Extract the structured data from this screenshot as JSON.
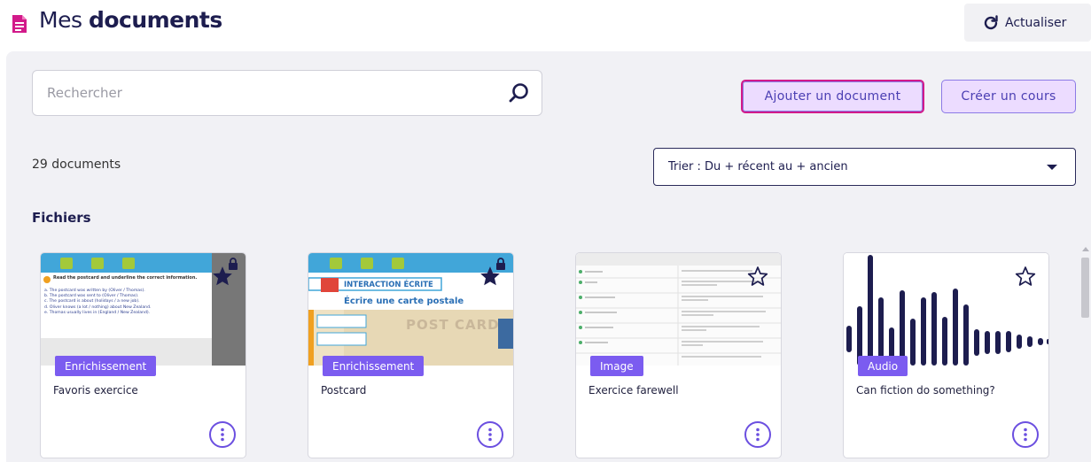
{
  "header": {
    "title_light": "Mes ",
    "title_bold": "documents",
    "refresh_label": "Actualiser"
  },
  "toolbar": {
    "search_placeholder": "Rechercher",
    "add_document_label": "Ajouter un document",
    "create_course_label": "Créer un cours"
  },
  "list": {
    "count_label": "29 documents",
    "sort_label": "Trier : Du + récent au + ancien",
    "section_title": "Fichiers"
  },
  "cards": [
    {
      "title": "Favoris exercice",
      "badge": "Enrichissement",
      "starred": true,
      "locked": true
    },
    {
      "title": "Postcard",
      "badge": "Enrichissement",
      "starred": true,
      "locked": true
    },
    {
      "title": "Exercice farewell",
      "badge": "Image",
      "starred": false,
      "locked": false
    },
    {
      "title": "Can fiction do something?",
      "badge": "Audio",
      "starred": false,
      "locked": false
    }
  ],
  "thumbs": {
    "exercise": {
      "instruction": "Read the postcard and underline the correct information.",
      "lines": [
        "a. The postcard was written by (Oliver / Thomas).",
        "b. The postcard was sent to (Oliver / Thomas).",
        "c. The postcard is about (holidays / a new job).",
        "d. Oliver knows (a lot / nothing) about New Zealand.",
        "e. Thomas usually lives in (England / New Zealand)."
      ]
    },
    "postcard": {
      "heading": "INTERACTION ÉCRITE",
      "subheading": "Écrire une carte postale",
      "stamp_text": "POST CARD"
    }
  },
  "colors": {
    "accent": "#7b5cf0",
    "brand_pink": "#d21a8a",
    "navy": "#1d1d4f"
  },
  "icons": {
    "title": "document-icon",
    "refresh": "refresh-icon",
    "search": "search-icon",
    "star_filled": "star-filled-icon",
    "star_outline": "star-outline-icon",
    "lock": "lock-icon",
    "more": "more-vertical-icon"
  }
}
